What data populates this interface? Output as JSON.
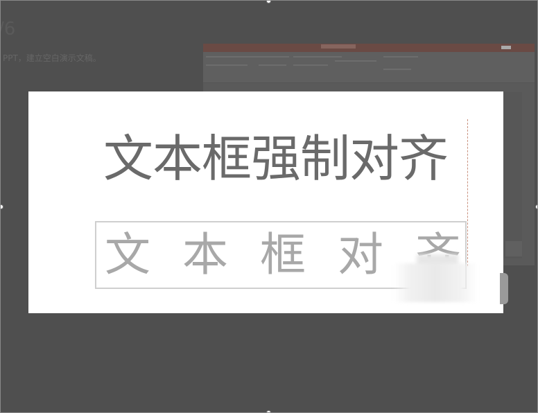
{
  "background_article": {
    "step_number": "/6",
    "step_text": "PPT，建立空白演示文稿。"
  },
  "slide": {
    "title_text": "文本框强制对齐",
    "textbox_chars": [
      "文",
      "本",
      "框",
      "对",
      "齐"
    ]
  }
}
